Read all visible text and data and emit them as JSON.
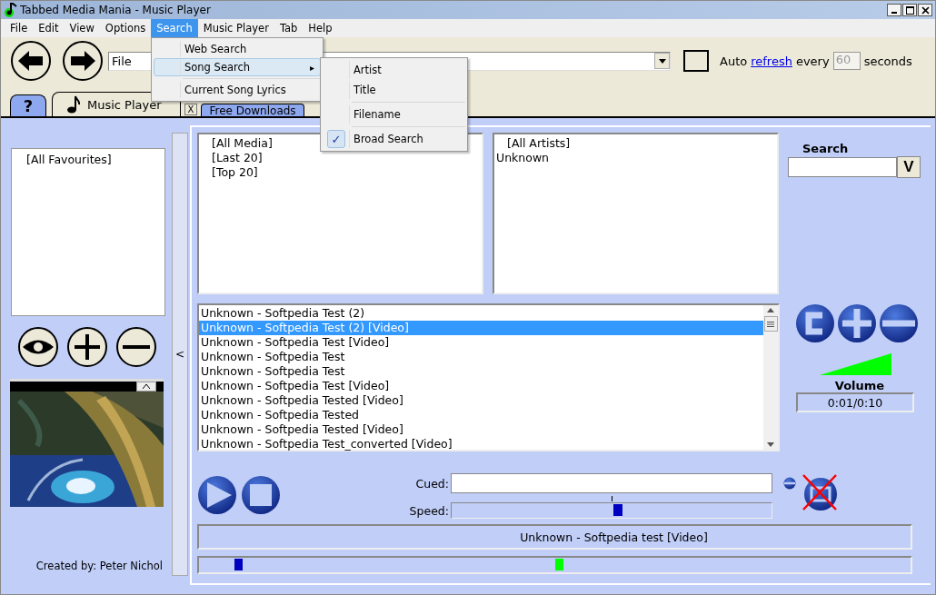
{
  "window": {
    "title": "Tabbed Media Mania - Music Player"
  },
  "menu_bar": [
    {
      "label": "File",
      "selected": false
    },
    {
      "label": "Edit",
      "selected": false
    },
    {
      "label": "View",
      "selected": false
    },
    {
      "label": "Options",
      "selected": false
    },
    {
      "label": "Search",
      "selected": true
    },
    {
      "label": "Music Player",
      "selected": false
    },
    {
      "label": "Tab",
      "selected": false
    },
    {
      "label": "Help",
      "selected": false
    }
  ],
  "search_menu": {
    "items": [
      {
        "kind": "item",
        "label": "Web Search",
        "selected": false
      },
      {
        "kind": "submenu",
        "label": "Song Search",
        "selected": true,
        "arrow": "▸"
      },
      {
        "kind": "separator"
      },
      {
        "kind": "item",
        "label": "Current Song Lyrics",
        "selected": false
      }
    ]
  },
  "song_search_menu": {
    "items": [
      {
        "kind": "item",
        "label": "Artist",
        "checked": false
      },
      {
        "kind": "item",
        "label": "Title",
        "checked": false
      },
      {
        "kind": "separator"
      },
      {
        "kind": "item",
        "label": "Filename",
        "checked": false
      },
      {
        "kind": "separator"
      },
      {
        "kind": "item",
        "label": "Broad Search",
        "checked": true,
        "check": "✓"
      }
    ]
  },
  "toolbar": {
    "address": {
      "value": "File"
    },
    "auto_refresh": {
      "checked": false,
      "before": "Auto",
      "link": "refresh",
      "after": "every",
      "interval": "60",
      "unit": "seconds",
      "disabled": true
    }
  },
  "tabs": [
    {
      "label": "?",
      "kind": "help",
      "selected": false
    },
    {
      "label": "Music Player",
      "kind": "music",
      "selected": true
    },
    {
      "label": "Free Downloads",
      "kind": "page",
      "selected": false
    }
  ],
  "tab_close": "X",
  "favourites": [
    "[All Favourites]"
  ],
  "creator": "Created by: Peter Nichol",
  "collapse": "<",
  "media_lists": [
    "[All Media]",
    "[Last 20]",
    "[Top 20]"
  ],
  "artists": [
    {
      "label": "[All Artists]",
      "kind": "group"
    },
    {
      "label": "Unknown",
      "kind": "entry"
    }
  ],
  "search": {
    "label": "Search",
    "button": "V"
  },
  "songs": [
    {
      "label": "Unknown - Softpedia Test (2)",
      "selected": false
    },
    {
      "label": "Unknown - Softpedia Test (2) [Video]",
      "selected": true
    },
    {
      "label": "Unknown - Softpedia Test [Video]",
      "selected": false
    },
    {
      "label": "Unknown - Softpedia Test",
      "selected": false
    },
    {
      "label": "Unknown - Softpedia Test",
      "selected": false
    },
    {
      "label": "Unknown - Softpedia Test [Video]",
      "selected": false
    },
    {
      "label": "Unknown - Softpedia Tested [Video]",
      "selected": false
    },
    {
      "label": "Unknown - Softpedia Tested",
      "selected": false
    },
    {
      "label": "Unknown - Softpedia Tested [Video]",
      "selected": false
    },
    {
      "label": "Unknown - Softpedia Test_converted [Video]",
      "selected": false
    }
  ],
  "volume": {
    "label": "Volume",
    "level": 1.0,
    "time": "0:01/0:10"
  },
  "cued": {
    "label": "Cued:"
  },
  "speed": {
    "label": "Speed:",
    "level": 0.52
  },
  "now_playing": "Unknown - Softpedia test [Video]",
  "position_markers": [
    {
      "level": 0.05,
      "color": "#0000c0"
    },
    {
      "level": 0.5,
      "color": "#00ff00"
    }
  ]
}
